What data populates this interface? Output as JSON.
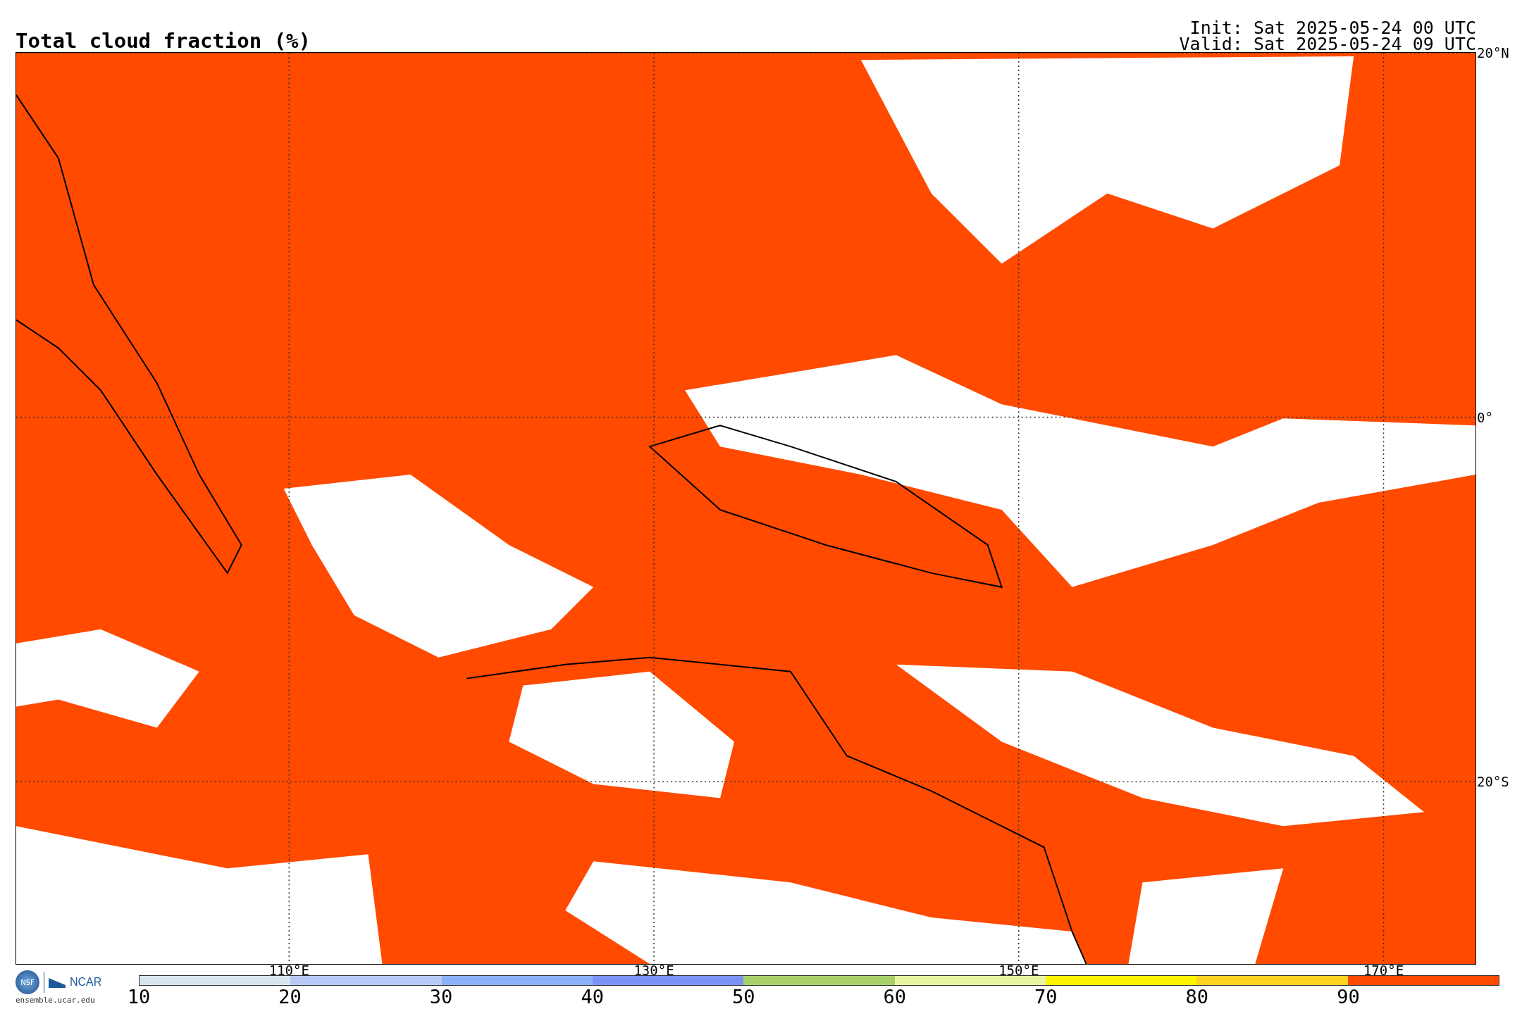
{
  "title": "Total cloud fraction (%)",
  "run_info": [
    "Init: Sat 2025-05-24 00 UTC",
    "Valid: Sat 2025-05-24 09 UTC"
  ],
  "map": {
    "lat_labels": [
      "20°N",
      "0°",
      "20°S"
    ],
    "lon_labels": [
      "110°E",
      "130°E",
      "150°E",
      "170°E"
    ]
  },
  "logos": {
    "nsf": "NSF",
    "ncar": "NCAR",
    "site": "ensemble.ucar.edu"
  },
  "colorbar": {
    "segments": [
      {
        "color": "#d9e6f0"
      },
      {
        "color": "#b6c9f7"
      },
      {
        "color": "#8bb0f8"
      },
      {
        "color": "#7b92f7"
      },
      {
        "color": "#a8d06a"
      },
      {
        "color": "#e8f5a0"
      },
      {
        "color": "#fff400"
      },
      {
        "color": "#ffd21f"
      },
      {
        "color": "#ff4a00"
      }
    ],
    "ticks": [
      "10",
      "20",
      "30",
      "40",
      "50",
      "60",
      "70",
      "80",
      "90"
    ]
  }
}
